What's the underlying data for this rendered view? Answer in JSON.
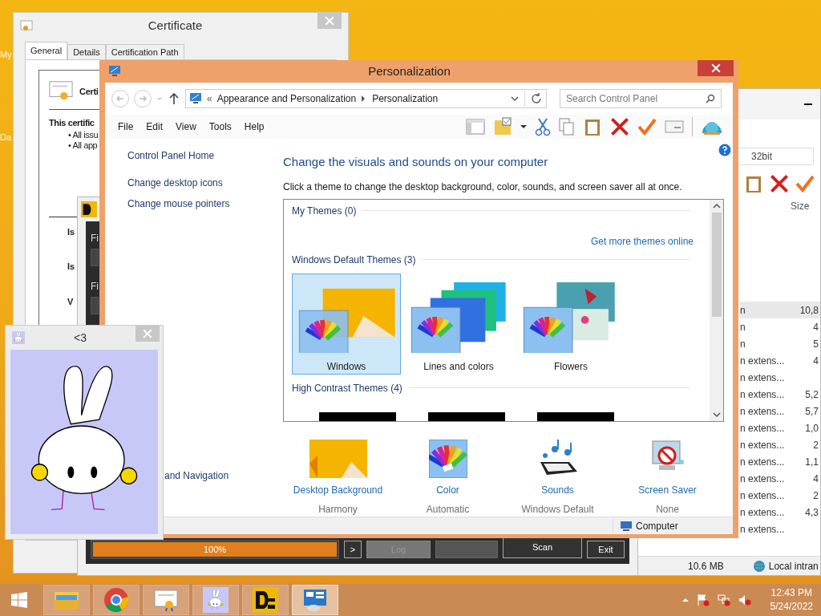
{
  "desktop_icons": [
    {
      "label": "My"
    },
    {
      "label": "Da"
    }
  ],
  "certificate_window": {
    "title": "Certificate",
    "tabs": [
      {
        "label": "General",
        "selected": true
      },
      {
        "label": "Details",
        "selected": false
      },
      {
        "label": "Certification Path",
        "selected": false
      }
    ],
    "heading": "Certi",
    "intro": "This certific",
    "bullets": [
      "• All issu",
      "• All app"
    ],
    "fields": [
      "Is",
      "Is",
      "V"
    ]
  },
  "explorer_window": {
    "address": "32bit",
    "column": "Size",
    "rows": [
      {
        "type": "n",
        "size": "10,8",
        "selected": true
      },
      {
        "type": "n",
        "size": "4",
        "selected": false
      },
      {
        "type": "n",
        "size": "5",
        "selected": false
      },
      {
        "type": "n extens...",
        "size": "4",
        "selected": false
      },
      {
        "type": "n extens...",
        "selected": false
      },
      {
        "type": "n extens...",
        "size": "5,2",
        "selected": false
      },
      {
        "type": "n extens...",
        "size": "5,7",
        "selected": false
      },
      {
        "type": "n extens...",
        "size": "1,0",
        "selected": false
      },
      {
        "type": "n extens...",
        "size": "2",
        "selected": false
      },
      {
        "type": "n extens...",
        "size": "1,1",
        "selected": false
      },
      {
        "type": "n extens...",
        "size": "4",
        "selected": false
      },
      {
        "type": "n extens...",
        "size": "2",
        "selected": false
      },
      {
        "type": "n extens...",
        "size": "4,3",
        "selected": false
      },
      {
        "type": "n extens...",
        "selected": false
      }
    ],
    "status": "10.6 MB",
    "zone": "Local intran"
  },
  "scanner_window": {
    "field_labels": [
      "Fi",
      "Fi"
    ],
    "progress": {
      "level": 1,
      "reading": "100%"
    },
    "buttons": [
      {
        "label": ">",
        "disabled": false
      },
      {
        "label": "Log",
        "disabled": true
      },
      {
        "label": "Scan",
        "disabled": false
      },
      {
        "label": "Exit",
        "disabled": false
      }
    ]
  },
  "personalization_window": {
    "title": "Personalization",
    "breadcrumb": {
      "prefix": "«",
      "items": [
        "Appearance and Personalization",
        "Personalization"
      ]
    },
    "search": {
      "placeholder": "Search Control Panel"
    },
    "menu": [
      "File",
      "Edit",
      "View",
      "Tools",
      "Help"
    ],
    "side_links": [
      "Control Panel Home",
      "Change desktop icons",
      "Change mouse pointers"
    ],
    "side_partial": "and Navigation",
    "heading": "Change the visuals and sounds on your computer",
    "description": "Click a theme to change the desktop background, color, sounds, and screen saver all at once.",
    "sections": [
      {
        "kind": "my",
        "title": "My Themes (0)",
        "link": "Get more themes online"
      },
      {
        "kind": "default",
        "title": "Windows Default Themes (3)",
        "themes": [
          {
            "kind": "windows",
            "name": "Windows",
            "selected": true
          },
          {
            "kind": "lines",
            "name": "Lines and colors",
            "selected": false
          },
          {
            "kind": "flowers",
            "name": "Flowers",
            "selected": false
          }
        ]
      },
      {
        "kind": "contrast",
        "title": "High Contrast Themes (4)"
      }
    ],
    "settings": [
      {
        "kind": "background",
        "label": "Desktop Background",
        "value": "Harmony"
      },
      {
        "kind": "color",
        "label": "Color",
        "value": "Automatic"
      },
      {
        "kind": "sounds",
        "label": "Sounds",
        "value": "Windows Default"
      },
      {
        "kind": "screensaver",
        "label": "Screen Saver",
        "value": "None"
      }
    ],
    "status": "Computer"
  },
  "bunny_window": {
    "title": "<3"
  },
  "taskbar": {
    "apps": [
      {
        "kind": "explorer",
        "selected": false
      },
      {
        "kind": "chrome",
        "selected": false
      },
      {
        "kind": "certificate",
        "selected": false
      },
      {
        "kind": "bunny",
        "selected": false
      },
      {
        "kind": "de",
        "selected": false
      },
      {
        "kind": "control",
        "selected": true
      }
    ],
    "time": "12:43 PM",
    "date": "5/24/2022"
  }
}
